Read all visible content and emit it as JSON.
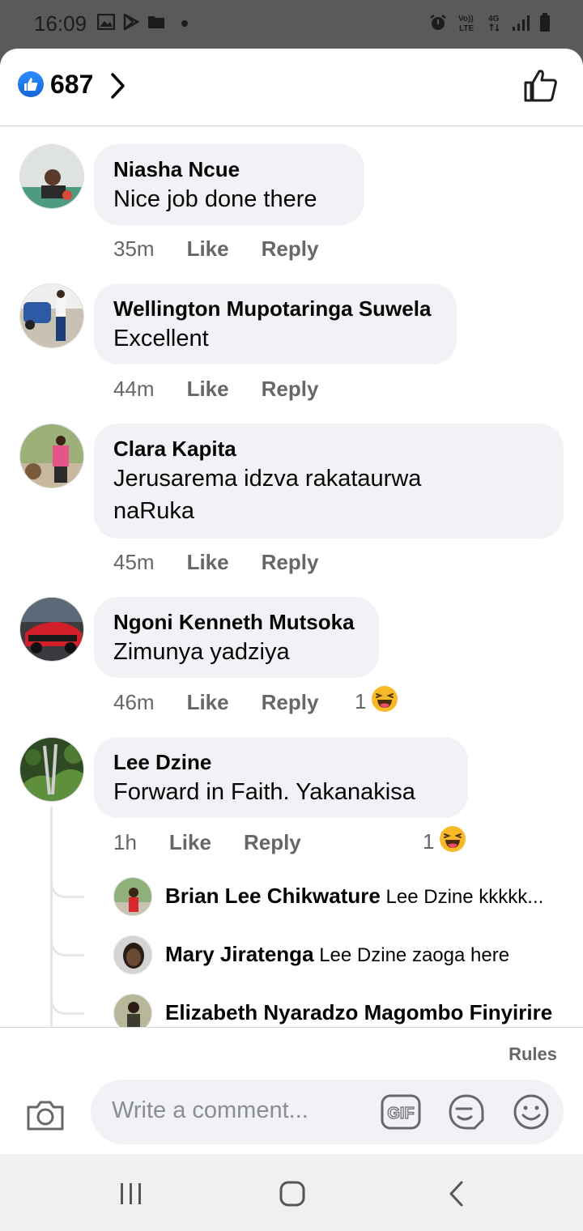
{
  "status_bar": {
    "time": "16:09",
    "left_icons": [
      "image-icon",
      "play-store-icon",
      "folder-icon",
      "dot-icon"
    ],
    "right_icons": [
      "alarm-icon",
      "volte-icon",
      "4g-icon",
      "signal-icon",
      "battery-icon"
    ],
    "volte_label": "Vo)) LTE",
    "network_label": "4G"
  },
  "header": {
    "reaction_count": "687",
    "reaction_icon": "like-badge-icon",
    "colors": {
      "like_blue": "#1877f2"
    }
  },
  "comments": [
    {
      "author": "Niasha Ncue",
      "text": "Nice job done there",
      "time": "35m",
      "like": "Like",
      "reply": "Reply"
    },
    {
      "author": "Wellington Mupotaringa Suwela",
      "text": "Excellent",
      "time": "44m",
      "like": "Like",
      "reply": "Reply"
    },
    {
      "author": "Clara Kapita",
      "text_lines": [
        "Jerusarema idzva rakataurwa",
        "naRuka"
      ],
      "time": "45m",
      "like": "Like",
      "reply": "Reply"
    },
    {
      "author": "Ngoni Kenneth Mutsoka",
      "text": "Zimunya yadziya",
      "time": "46m",
      "like": "Like",
      "reply": "Reply",
      "reaction_count": "1",
      "reaction": "haha"
    },
    {
      "author": "Lee Dzine",
      "text": "Forward in Faith. Yakanakisa",
      "time": "1h",
      "like": "Like",
      "reply": "Reply",
      "reaction_count": "1",
      "reaction": "haha"
    }
  ],
  "replies": [
    {
      "author": "Brian Lee Chikwature",
      "text": "Lee Dzine kkkkk..."
    },
    {
      "author": "Mary Jiratenga",
      "text": "Lee Dzine zaoga here"
    },
    {
      "author": "Elizabeth Nyaradzo Magombo Finyirire",
      "text": ""
    }
  ],
  "composer": {
    "rules": "Rules",
    "placeholder": "Write a comment...",
    "gif_label": "GIF"
  }
}
